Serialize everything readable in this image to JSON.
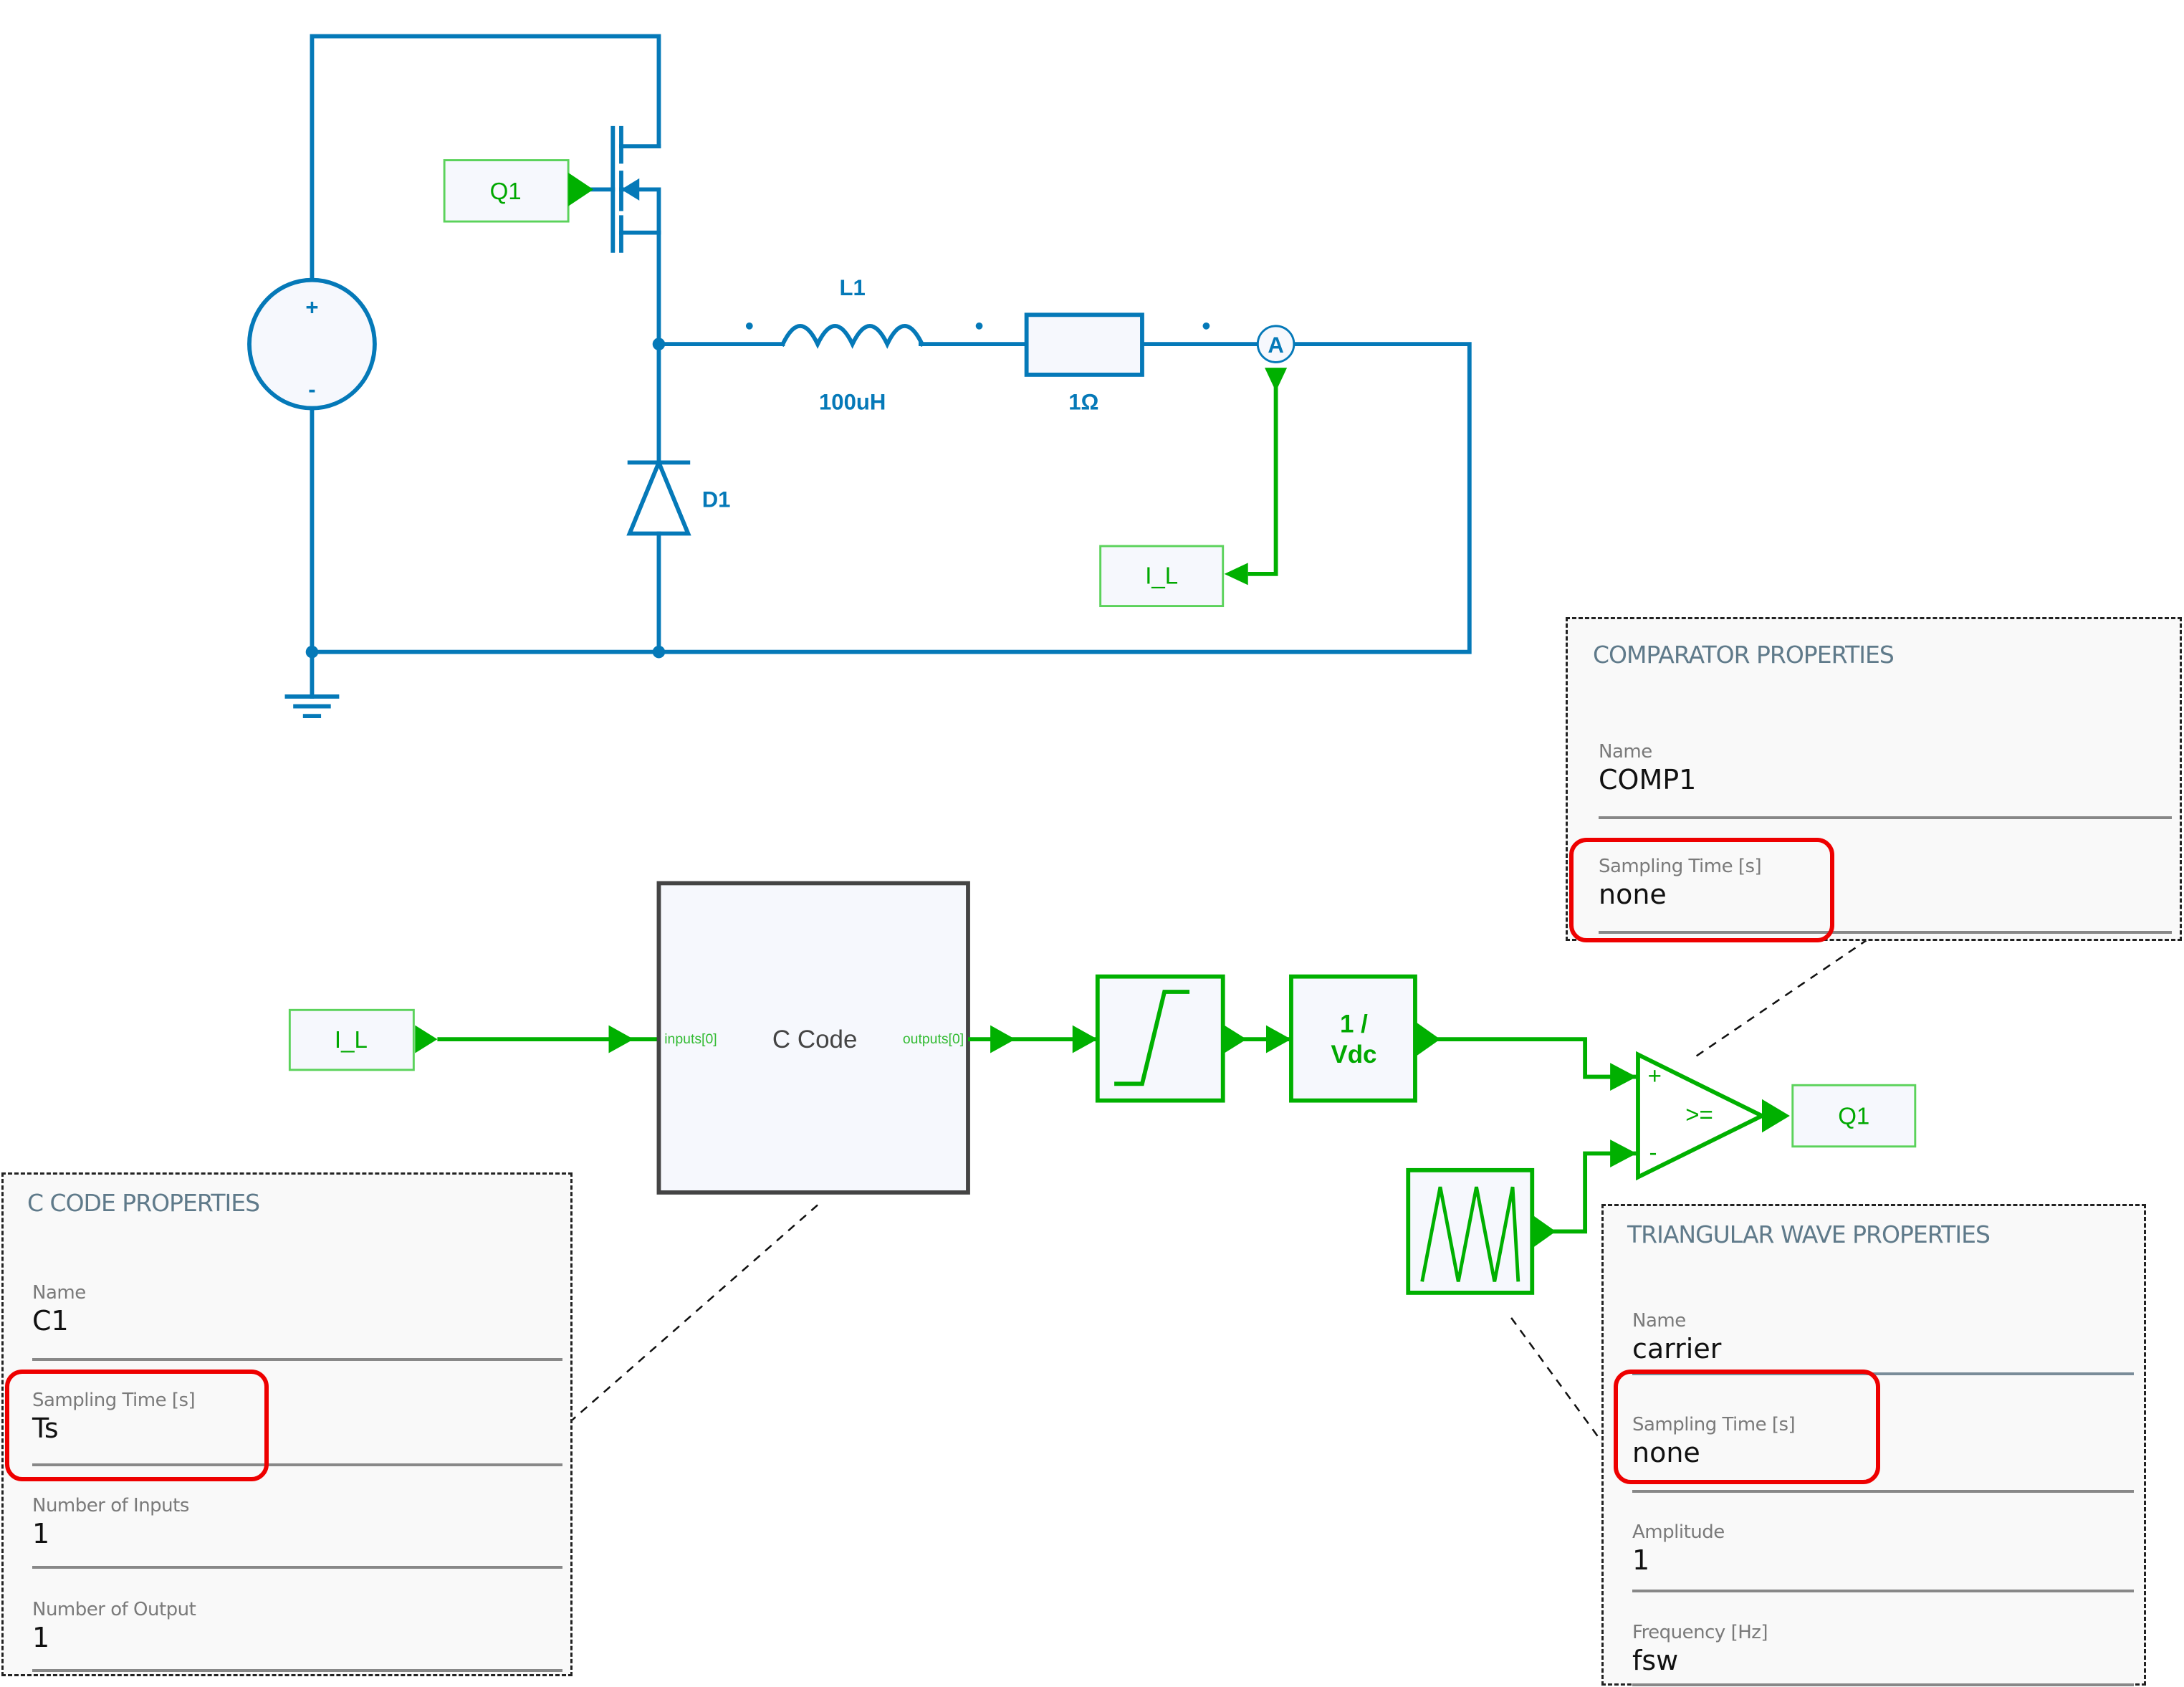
{
  "circuit": {
    "source": {
      "plus_label": "+",
      "minus_label": "-"
    },
    "switch_gate_tag": "Q1",
    "inductor": {
      "name": "L1",
      "value": "100uH"
    },
    "resistor": {
      "value": "1Ω"
    },
    "ammeter": {
      "label": "A"
    },
    "diode": {
      "name": "D1"
    },
    "current_tag": "I_L"
  },
  "control": {
    "input_tag": "I_L",
    "c_code_block": {
      "title": "C Code",
      "input_port": "inputs[0]",
      "output_port": "outputs[0]"
    },
    "gain_block": {
      "line1": "1 /",
      "line2": "Vdc"
    },
    "comparator": {
      "plus": "+",
      "minus": "-",
      "operator": ">="
    },
    "output_tag": "Q1"
  },
  "panels": {
    "comparator": {
      "title": "COMPARATOR PROPERTIES",
      "fields": [
        {
          "label": "Name",
          "value": "COMP1",
          "highlighted": false
        },
        {
          "label": "Sampling Time [s]",
          "value": "none",
          "highlighted": true
        }
      ]
    },
    "c_code": {
      "title": "C CODE PROPERTIES",
      "fields": [
        {
          "label": "Name",
          "value": "C1",
          "highlighted": false
        },
        {
          "label": "Sampling Time [s]",
          "value": "Ts",
          "highlighted": true
        },
        {
          "label": "Number of Inputs",
          "value": "1",
          "highlighted": false
        },
        {
          "label": "Number of Output",
          "value": "1",
          "highlighted": false
        }
      ]
    },
    "triangular_wave": {
      "title": "TRIANGULAR WAVE PROPERTIES",
      "fields": [
        {
          "label": "Name",
          "value": "carrier",
          "highlighted": false
        },
        {
          "label": "Sampling Time [s]",
          "value": "none",
          "highlighted": true
        },
        {
          "label": "Amplitude",
          "value": "1",
          "highlighted": false
        },
        {
          "label": "Frequency [Hz]",
          "value": "fsw",
          "highlighted": false
        }
      ]
    }
  },
  "colors": {
    "power_wire": "#0579B8",
    "signal_wire": "#00B000",
    "highlight": "#EE0000"
  }
}
